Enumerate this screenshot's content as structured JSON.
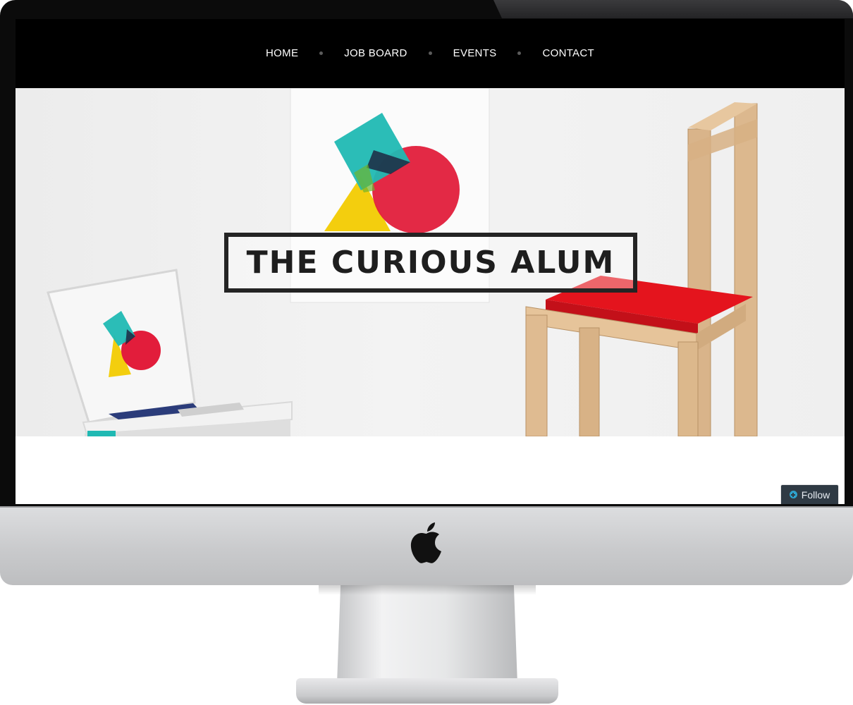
{
  "nav": {
    "items": [
      {
        "label": "HOME"
      },
      {
        "label": "JOB BOARD"
      },
      {
        "label": "EVENTS"
      },
      {
        "label": "CONTACT"
      }
    ]
  },
  "hero": {
    "site_title": "THE CURIOUS ALUM"
  },
  "follow": {
    "label": "Follow",
    "icon": "plus-circle-icon"
  },
  "device": {
    "logo": "apple-logo-icon"
  },
  "colors": {
    "nav_background": "#000000",
    "logo_teal": "#20b9b3",
    "logo_red": "#e21d3b",
    "logo_yellow": "#f3ce0e",
    "chair_seat": "#e4141d",
    "follow_background": "#2f3a44",
    "follow_icon": "#2ea2cc"
  }
}
